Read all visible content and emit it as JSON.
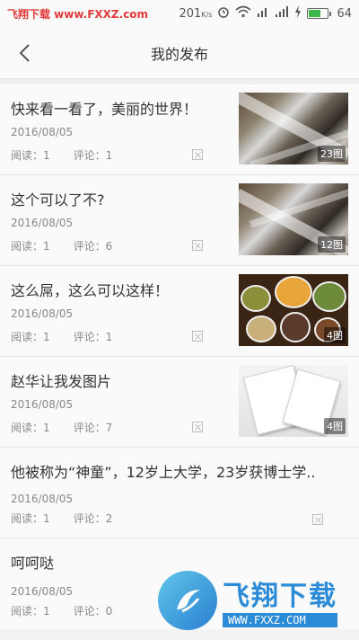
{
  "status_bar": {
    "watermark": "飞翔下载 www.FXXZ.com",
    "speed": "201",
    "speed_unit": "K/s",
    "battery": "64"
  },
  "header": {
    "title": "我的发布"
  },
  "labels": {
    "read": "阅读：",
    "comment": "评论："
  },
  "posts": [
    {
      "title": "快来看一看了，美丽的世界！",
      "date": "2016/08/05",
      "reads": "1",
      "comments": "1",
      "image_count": "23图"
    },
    {
      "title": "这个可以了不?",
      "date": "2016/08/05",
      "reads": "1",
      "comments": "6",
      "image_count": "12图"
    },
    {
      "title": "这么屌，这么可以这样！",
      "date": "2016/08/05",
      "reads": "1",
      "comments": "1",
      "image_count": "4图"
    },
    {
      "title": "赵华让我发图片",
      "date": "2016/08/05",
      "reads": "1",
      "comments": "7",
      "image_count": "4图"
    },
    {
      "title": "他被称为“神童”，12岁上大学，23岁获博士学..",
      "date": "2016/08/05",
      "reads": "1",
      "comments": "2"
    },
    {
      "title": "呵呵哒",
      "date": "2016/08/05",
      "reads": "1",
      "comments": "0"
    }
  ],
  "watermark_logo": {
    "text": "飞翔下载",
    "url": "WWW.FXXZ.COM"
  },
  "colors": {
    "accent": "#2b8bd6",
    "watermark_red": "#e23b3b",
    "battery": "#3bb84a"
  }
}
